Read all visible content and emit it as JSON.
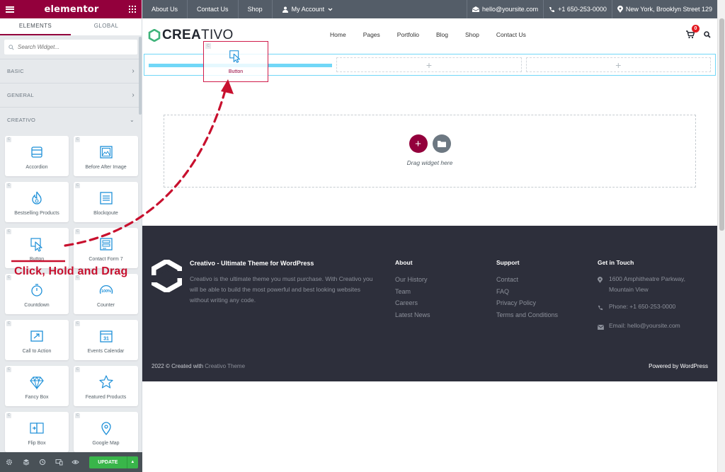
{
  "panel": {
    "logo": "elementor",
    "tabs": [
      "ELEMENTS",
      "GLOBAL"
    ],
    "search_placeholder": "Search Widget...",
    "categories": [
      {
        "label": "BASIC",
        "chevron": "chevron-right-icon"
      },
      {
        "label": "GENERAL",
        "chevron": "chevron-right-icon"
      },
      {
        "label": "CREATIVO",
        "chevron": "chevron-down-icon"
      }
    ],
    "widgets": [
      {
        "label": "Accordion",
        "icon": "accordion-icon"
      },
      {
        "label": "Before After Image",
        "icon": "image-icon"
      },
      {
        "label": "Bestselling Products",
        "icon": "flame-icon"
      },
      {
        "label": "Blockqoute",
        "icon": "blockquote-icon"
      },
      {
        "label": "Button",
        "icon": "cursor-icon"
      },
      {
        "label": "Contact Form 7",
        "icon": "form-icon"
      },
      {
        "label": "Countdown",
        "icon": "stopwatch-icon"
      },
      {
        "label": "Counter",
        "icon": "counter-icon"
      },
      {
        "label": "Call to Action",
        "icon": "call-to-action-icon"
      },
      {
        "label": "Events Calendar",
        "icon": "calendar-icon"
      },
      {
        "label": "Fancy Box",
        "icon": "diamond-icon"
      },
      {
        "label": "Featured Products",
        "icon": "star-icon"
      },
      {
        "label": "Flip Box",
        "icon": "flip-box-icon"
      },
      {
        "label": "Google Map",
        "icon": "map-pin-icon"
      }
    ],
    "update_label": "UPDATE",
    "accent": "#93003c",
    "update_color": "#39b54a"
  },
  "topbar": {
    "links": [
      "About Us",
      "Contact Us",
      "Shop"
    ],
    "account": "My Account",
    "email": "hello@yoursite.com",
    "phone": "+1 650-253-0000",
    "address": "New York, Brooklyn Street 129"
  },
  "header": {
    "brand_bold": "CREA",
    "brand_light": "TIVO",
    "nav": [
      "Home",
      "Pages",
      "Portfolio",
      "Blog",
      "Shop",
      "Contact Us"
    ],
    "cart_count": "0"
  },
  "editor": {
    "drag_widget_label": "Button",
    "drop_text": "Drag widget here",
    "col_plus": "+"
  },
  "footer": {
    "title": "Creativo - Ultimate Theme for WordPress",
    "description": "Creativo is the ultimate theme you must purchase. With Creativo you will be able to build the most powerful and best looking websites without writing any code.",
    "about": {
      "heading": "About",
      "links": [
        "Our History",
        "Team",
        "Careers",
        "Latest News"
      ]
    },
    "support": {
      "heading": "Support",
      "links": [
        "Contact",
        "FAQ",
        "Privacy Policy",
        "Terms and Conditions"
      ]
    },
    "touch": {
      "heading": "Get in Touch",
      "address": "1600 Amphitheatre Parkway, Mountain View",
      "phone": "Phone: +1 650-253-0000",
      "email": "Email: hello@yoursite.com"
    },
    "copyright_prefix": "2022 © Created with ",
    "copyright_link": "Creativo Theme",
    "powered": "Powered by WordPress",
    "bg": "#2d2f3b"
  },
  "annotation": {
    "text": "Click, Hold and Drag",
    "color": "#c8102e"
  }
}
